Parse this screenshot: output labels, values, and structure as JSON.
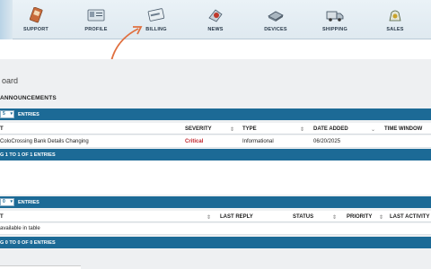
{
  "nav": {
    "items": [
      {
        "label": "SUPPORT",
        "icon": "support-icon"
      },
      {
        "label": "PROFILE",
        "icon": "profile-icon"
      },
      {
        "label": "BILLING",
        "icon": "billing-icon"
      },
      {
        "label": "NEWS",
        "icon": "news-icon"
      },
      {
        "label": "DEVICES",
        "icon": "devices-icon"
      },
      {
        "label": "SHIPPING",
        "icon": "shipping-icon"
      },
      {
        "label": "SALES",
        "icon": "sales-icon"
      }
    ]
  },
  "page": {
    "title": "oard"
  },
  "announcements": {
    "title": "ANNOUNCEMENTS",
    "entries_value": "5",
    "entries_label": "ENTRIES",
    "columns": {
      "title": "T",
      "severity": "SEVERITY",
      "type": "TYPE",
      "date_added": "DATE ADDED",
      "time_window": "TIME WINDOW"
    },
    "rows": [
      {
        "title": "ColoCrossing Bank Details Changing",
        "severity": "Critical",
        "type": "Informational",
        "date": "06/20/2025"
      }
    ],
    "footer": "G 1 TO 1 OF 1 ENTRIES"
  },
  "tickets": {
    "entries_value": "0",
    "entries_label": "ENTRIES",
    "columns": {
      "title": "T",
      "last_reply": "LAST REPLY",
      "status": "STATUS",
      "priority": "PRIORITY",
      "last_activity": "LAST ACTIVITY"
    },
    "empty": "available in table",
    "footer": "G 0 TO 0 OF 0 ENTRIES"
  },
  "colors": {
    "bar": "#1c6a96",
    "critical": "#c0262d",
    "arrow": "#e07040"
  }
}
